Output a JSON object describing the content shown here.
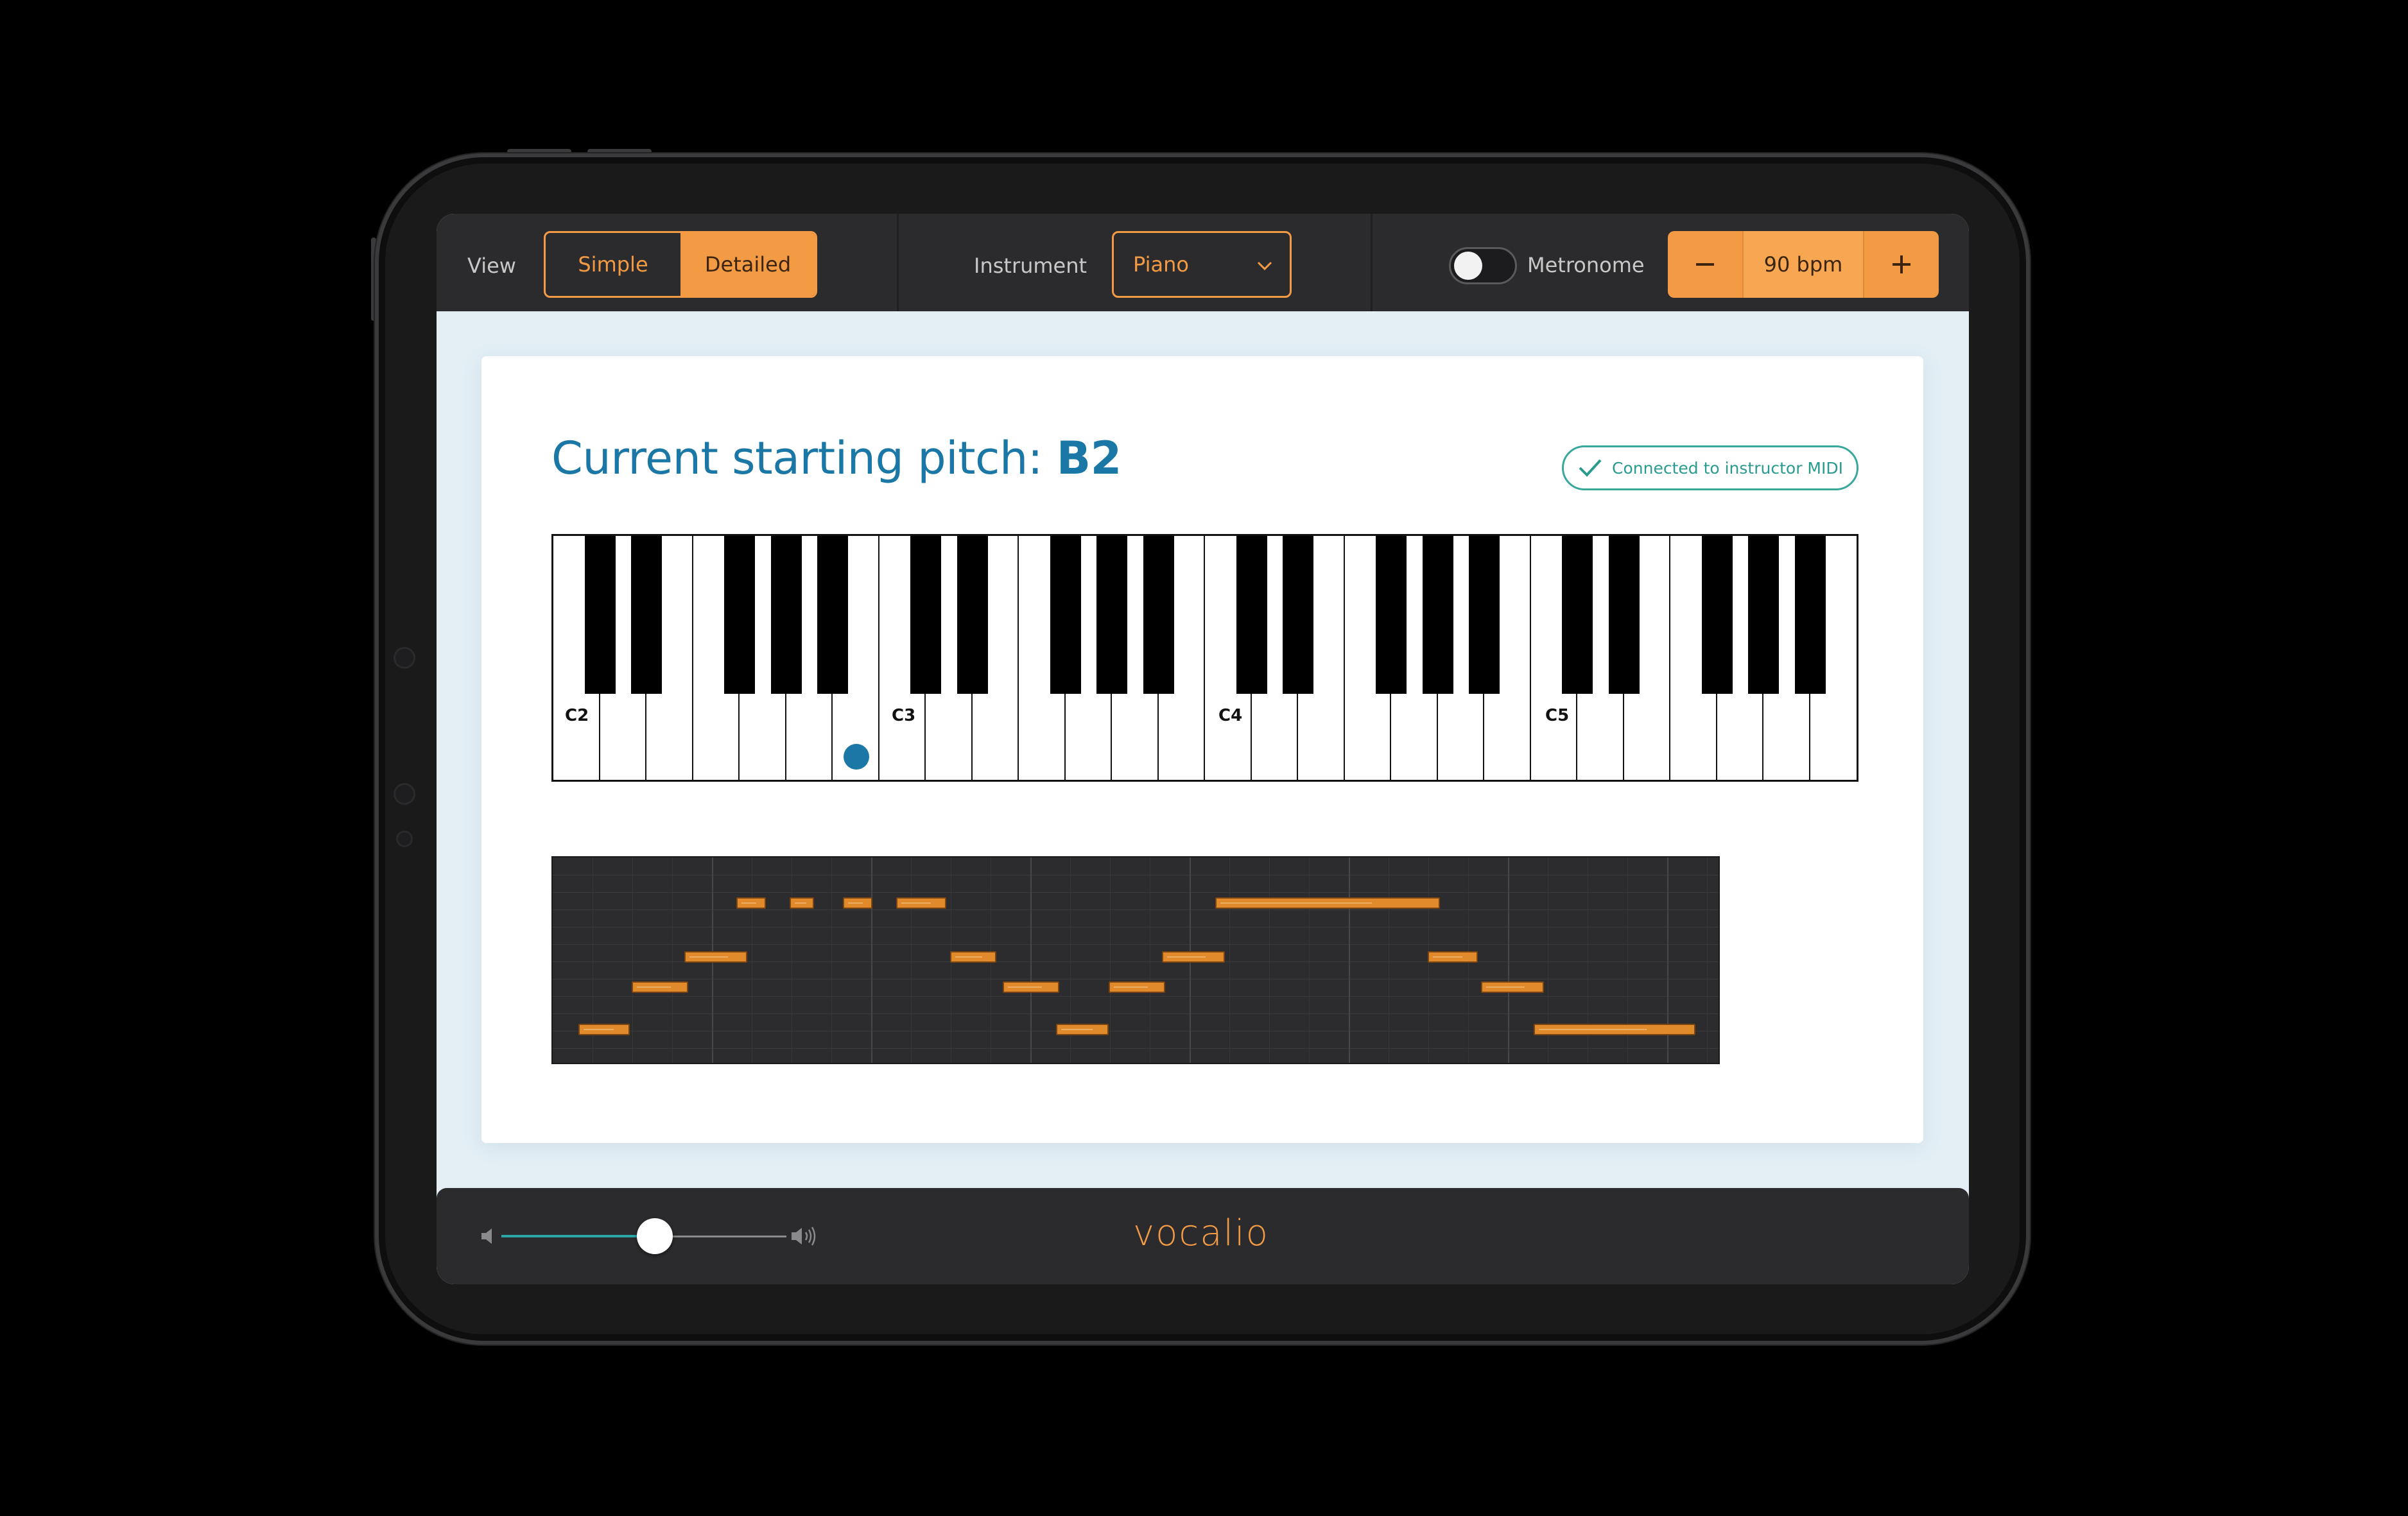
{
  "toolbar": {
    "view_label": "View",
    "view_options": [
      "Simple",
      "Detailed"
    ],
    "view_selected": "Detailed",
    "instrument_label": "Instrument",
    "instrument_value": "Piano",
    "metronome_label": "Metronome",
    "metronome_on": false,
    "tempo_value": "90 bpm",
    "minus_icon": "minus-icon",
    "plus_icon": "plus-icon"
  },
  "main": {
    "title_prefix": "Current starting pitch: ",
    "title_pitch": "B2",
    "status_badge": "Connected to instructor MIDI",
    "status_icon": "check-icon",
    "keyboard": {
      "octave_labels": [
        "C2",
        "C3",
        "C4",
        "C5"
      ],
      "selected_note": "B2"
    }
  },
  "footer": {
    "volume_level": 0.46,
    "volume_low_icon": "speaker-low-icon",
    "volume_high_icon": "speaker-high-icon",
    "logo": "vocalio"
  },
  "colors": {
    "accent": "#f39a45",
    "title_blue": "#1b78a6",
    "status_green": "#2a9b8f",
    "background": "#e3eff5"
  }
}
